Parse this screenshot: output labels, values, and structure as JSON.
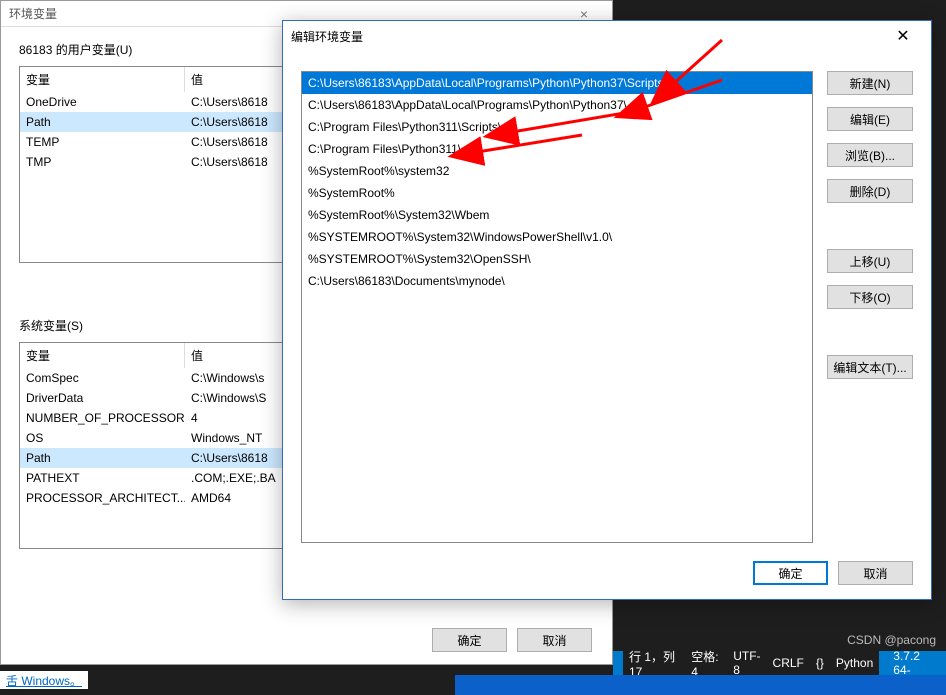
{
  "back_dialog": {
    "title": "环境变量",
    "user_section_label": "86183 的用户变量(U)",
    "system_section_label": "系统变量(S)",
    "columns": {
      "variable": "变量",
      "value": "值"
    },
    "user_rows": [
      {
        "var": "OneDrive",
        "val": "C:\\Users\\8618"
      },
      {
        "var": "Path",
        "val": "C:\\Users\\8618"
      },
      {
        "var": "TEMP",
        "val": "C:\\Users\\8618"
      },
      {
        "var": "TMP",
        "val": "C:\\Users\\8618"
      }
    ],
    "user_selected_index": 1,
    "system_rows": [
      {
        "var": "ComSpec",
        "val": "C:\\Windows\\s"
      },
      {
        "var": "DriverData",
        "val": "C:\\Windows\\S"
      },
      {
        "var": "NUMBER_OF_PROCESSORS",
        "val": "4"
      },
      {
        "var": "OS",
        "val": "Windows_NT"
      },
      {
        "var": "Path",
        "val": "C:\\Users\\8618"
      },
      {
        "var": "PATHEXT",
        "val": ".COM;.EXE;.BA"
      },
      {
        "var": "PROCESSOR_ARCHITECT...",
        "val": "AMD64"
      }
    ],
    "system_selected_index": 4,
    "buttons": {
      "ok": "确定",
      "cancel": "取消"
    }
  },
  "front_dialog": {
    "title": "编辑环境变量",
    "paths": [
      "C:\\Users\\86183\\AppData\\Local\\Programs\\Python\\Python37\\Scripts\\",
      "C:\\Users\\86183\\AppData\\Local\\Programs\\Python\\Python37\\",
      "C:\\Program Files\\Python311\\Scripts\\",
      "C:\\Program Files\\Python311\\",
      "%SystemRoot%\\system32",
      "%SystemRoot%",
      "%SystemRoot%\\System32\\Wbem",
      "%SYSTEMROOT%\\System32\\WindowsPowerShell\\v1.0\\",
      "%SYSTEMROOT%\\System32\\OpenSSH\\",
      "C:\\Users\\86183\\Documents\\mynode\\"
    ],
    "selected_index": 0,
    "side_buttons": {
      "new": "新建(N)",
      "edit": "编辑(E)",
      "browse": "浏览(B)...",
      "delete": "删除(D)",
      "move_up": "上移(U)",
      "move_down": "下移(O)",
      "edit_text": "编辑文本(T)..."
    },
    "footer": {
      "ok": "确定",
      "cancel": "取消"
    }
  },
  "statusbar": {
    "line_col": "行 1，列 17",
    "spaces": "空格: 4",
    "encoding": "UTF-8",
    "eol": "CRLF",
    "lang_icon": "{}",
    "lang": "Python",
    "version": "3.7.2 64-"
  },
  "watermark": "CSDN @pacong",
  "activate_text": "舌 Windows。"
}
